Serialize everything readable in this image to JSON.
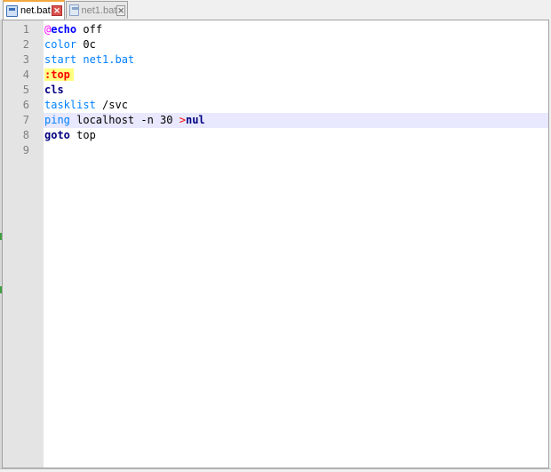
{
  "tabs": [
    {
      "label": "net.bat",
      "active": true,
      "icon": "file-icon"
    },
    {
      "label": "net1.bat",
      "active": false,
      "icon": "file-icon"
    }
  ],
  "editor": {
    "current_line": 7,
    "lines": [
      {
        "num": "1",
        "tokens": [
          {
            "t": "@",
            "c": "at"
          },
          {
            "t": "echo",
            "c": "kw"
          },
          {
            "t": " off",
            "c": "plain"
          }
        ]
      },
      {
        "num": "2",
        "tokens": [
          {
            "t": "color",
            "c": "cmd"
          },
          {
            "t": " 0c",
            "c": "plain"
          }
        ]
      },
      {
        "num": "3",
        "tokens": [
          {
            "t": "start",
            "c": "cmd"
          },
          {
            "t": " net1.bat",
            "c": "cmd"
          }
        ]
      },
      {
        "num": "4",
        "tokens": [
          {
            "t": ":top",
            "c": "lbl"
          }
        ]
      },
      {
        "num": "5",
        "tokens": [
          {
            "t": "cls",
            "c": "kw-dark"
          }
        ]
      },
      {
        "num": "6",
        "tokens": [
          {
            "t": "tasklist",
            "c": "cmd"
          },
          {
            "t": " /svc",
            "c": "plain"
          }
        ]
      },
      {
        "num": "7",
        "tokens": [
          {
            "t": "ping",
            "c": "cmd"
          },
          {
            "t": " localhost -n 30 ",
            "c": "plain"
          },
          {
            "t": ">",
            "c": "redir"
          },
          {
            "t": "nul",
            "c": "kw-dark"
          }
        ]
      },
      {
        "num": "8",
        "tokens": [
          {
            "t": "goto",
            "c": "kw-dark"
          },
          {
            "t": " top",
            "c": "plain"
          }
        ]
      },
      {
        "num": "9",
        "tokens": []
      }
    ]
  },
  "colors": {
    "active_tab_accent": "#f3a740",
    "gutter": "#e4e4e4",
    "current_line": "#e8e8ff",
    "label_highlight": "#ffff80"
  }
}
